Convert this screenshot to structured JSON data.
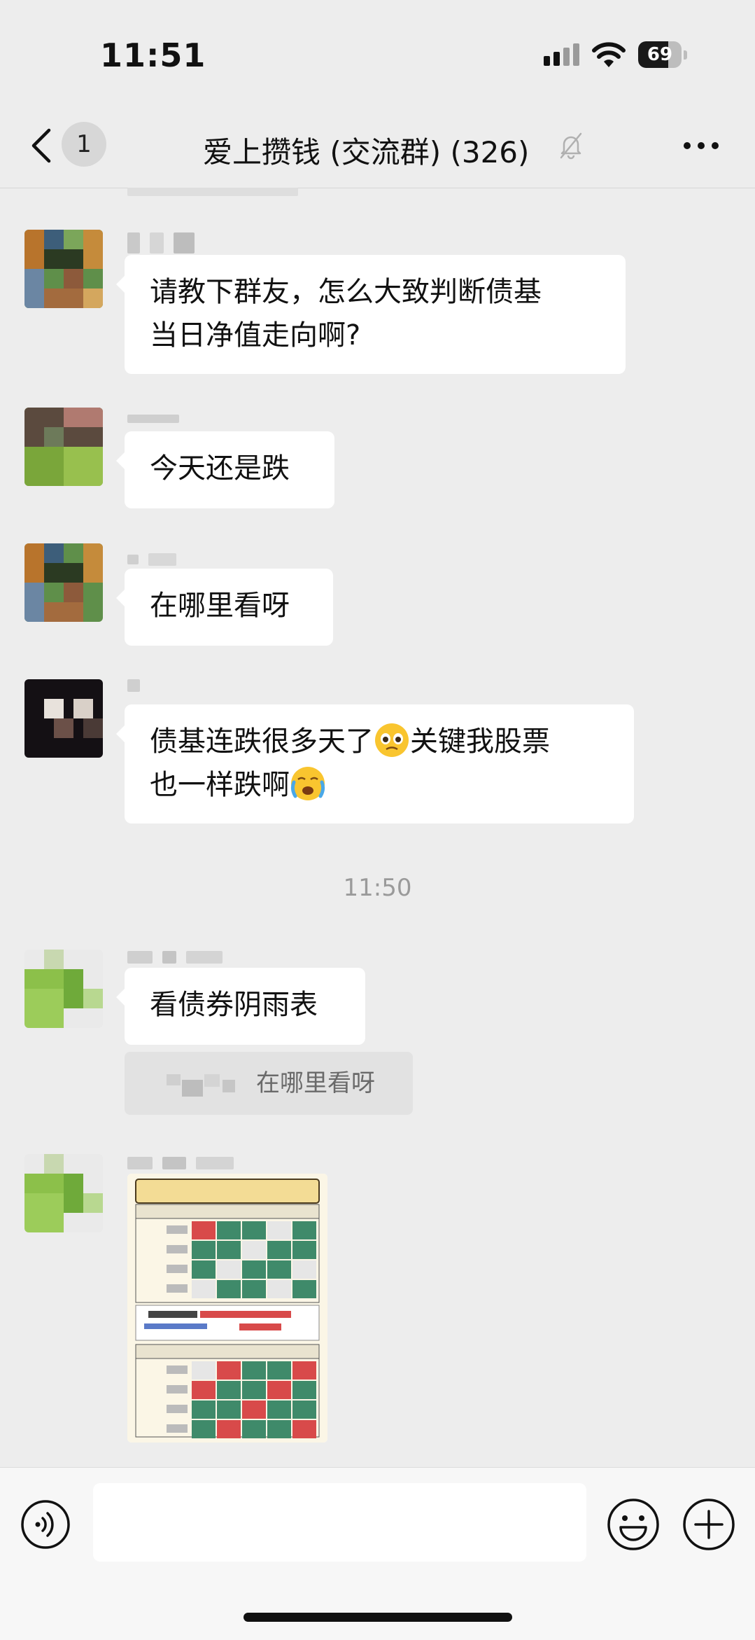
{
  "status_bar": {
    "time": "11:51",
    "battery": "69",
    "battery_level": 0.69
  },
  "nav": {
    "badge": "1",
    "title": "爱上攒钱 (交流群) (326)"
  },
  "messages": [
    {
      "text_lines": [
        "请教下群友，怎么大致判断债基",
        "当日净值走向啊?"
      ]
    },
    {
      "text_lines": [
        "今天还是跌"
      ]
    },
    {
      "text_lines": [
        "在哪里看呀"
      ]
    },
    {
      "segments": [
        "债基连跌很多天了",
        "关键我股票",
        "也一样跌啊"
      ],
      "emojis": [
        "pleading-face-emoji",
        "crying-face-emoji"
      ]
    },
    {
      "text_lines": [
        "看债券阴雨表"
      ]
    }
  ],
  "time_divider": "11:50",
  "quote": {
    "text": "在哪里看呀"
  },
  "image_message": {
    "icon": "bond-weather-table-image"
  },
  "input": {
    "placeholder": ""
  },
  "colors": {
    "background": "#ededed",
    "bubble": "#ffffff",
    "quote": "#e2e2e2"
  }
}
